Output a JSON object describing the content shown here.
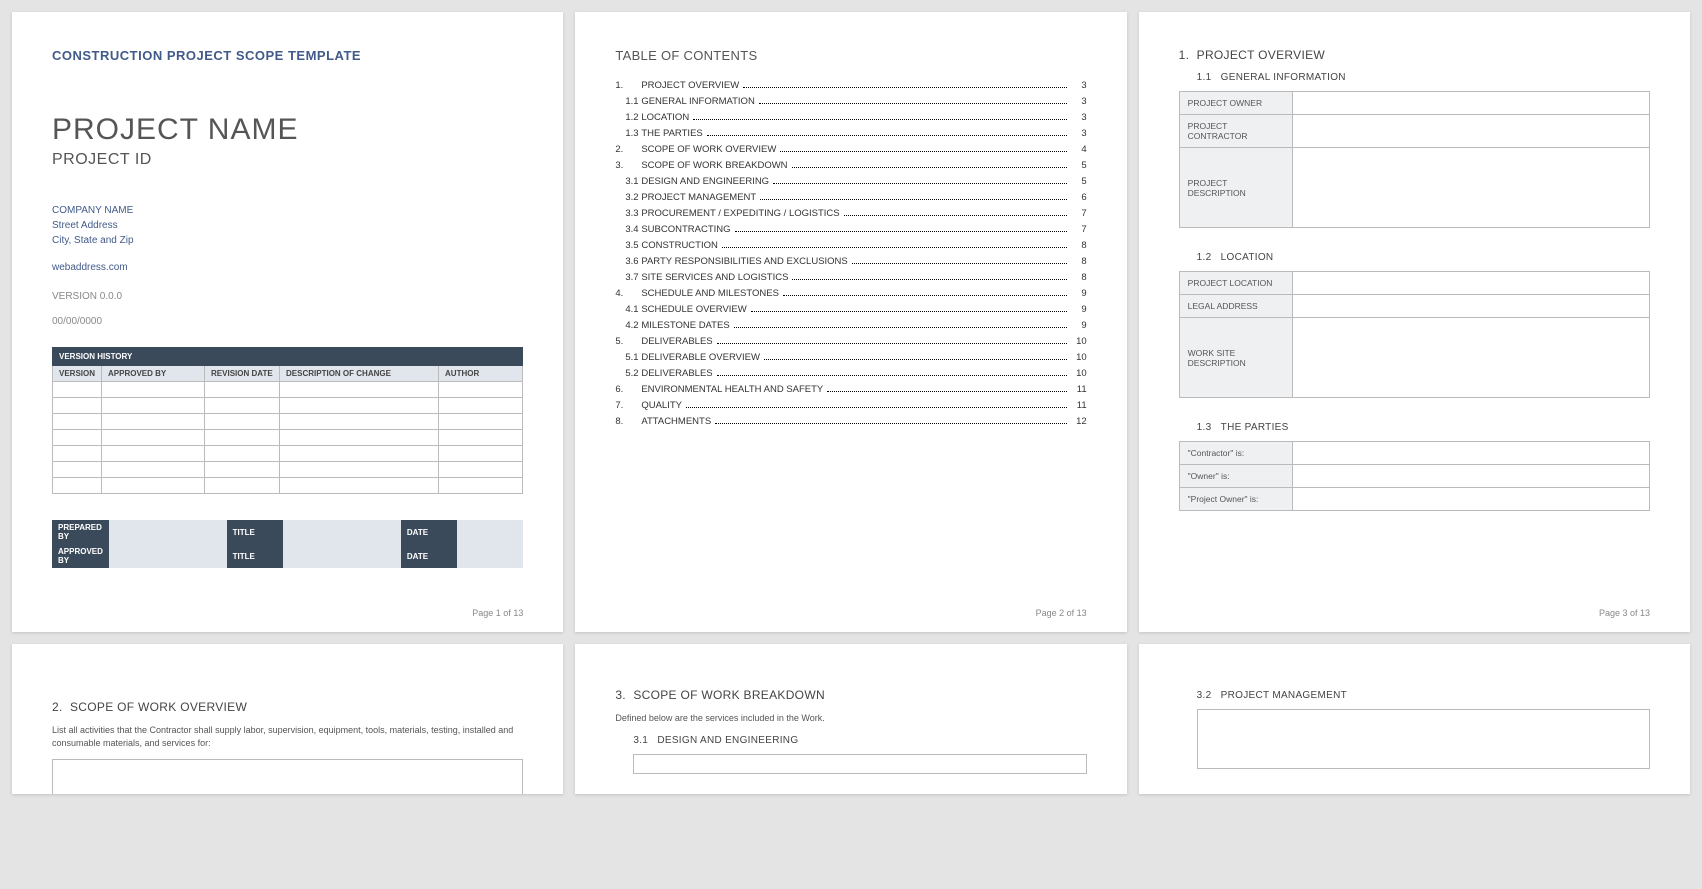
{
  "totalPages": "13",
  "page1": {
    "templateTitle": "CONSTRUCTION PROJECT SCOPE TEMPLATE",
    "projectName": "PROJECT NAME",
    "projectId": "PROJECT ID",
    "company": "COMPANY NAME",
    "street": "Street Address",
    "cityState": "City, State and Zip",
    "web": "webaddress.com",
    "version": "VERSION 0.0.0",
    "date": "00/00/0000",
    "versionHistoryTitle": "VERSION HISTORY",
    "colVersion": "VERSION",
    "colApproved": "APPROVED BY",
    "colRevDate": "REVISION DATE",
    "colDesc": "DESCRIPTION OF CHANGE",
    "colAuthor": "AUTHOR",
    "preparedBy": "PREPARED BY",
    "approvedBy": "APPROVED BY",
    "titleLabel": "TITLE",
    "dateLabel": "DATE",
    "footer": "Page 1 of 13"
  },
  "page2": {
    "title": "TABLE OF CONTENTS",
    "entries": [
      {
        "num": "1.",
        "label": "PROJECT OVERVIEW",
        "page": "3",
        "sub": false
      },
      {
        "num": "1.1",
        "label": "GENERAL INFORMATION",
        "page": "3",
        "sub": true
      },
      {
        "num": "1.2",
        "label": "LOCATION",
        "page": "3",
        "sub": true
      },
      {
        "num": "1.3",
        "label": "THE PARTIES",
        "page": "3",
        "sub": true
      },
      {
        "num": "2.",
        "label": "SCOPE OF WORK OVERVIEW",
        "page": "4",
        "sub": false
      },
      {
        "num": "3.",
        "label": "SCOPE OF WORK BREAKDOWN",
        "page": "5",
        "sub": false
      },
      {
        "num": "3.1",
        "label": "DESIGN AND ENGINEERING",
        "page": "5",
        "sub": true
      },
      {
        "num": "3.2",
        "label": "PROJECT MANAGEMENT",
        "page": "6",
        "sub": true
      },
      {
        "num": "3.3",
        "label": "PROCUREMENT / EXPEDITING / LOGISTICS",
        "page": "7",
        "sub": true
      },
      {
        "num": "3.4",
        "label": "SUBCONTRACTING",
        "page": "7",
        "sub": true
      },
      {
        "num": "3.5",
        "label": "CONSTRUCTION",
        "page": "8",
        "sub": true
      },
      {
        "num": "3.6",
        "label": "PARTY RESPONSIBILITIES AND EXCLUSIONS",
        "page": "8",
        "sub": true
      },
      {
        "num": "3.7",
        "label": "SITE SERVICES AND LOGISTICS",
        "page": "8",
        "sub": true
      },
      {
        "num": "4.",
        "label": "SCHEDULE AND MILESTONES",
        "page": "9",
        "sub": false
      },
      {
        "num": "4.1",
        "label": "SCHEDULE OVERVIEW",
        "page": "9",
        "sub": true
      },
      {
        "num": "4.2",
        "label": "MILESTONE DATES",
        "page": "9",
        "sub": true
      },
      {
        "num": "5.",
        "label": "DELIVERABLES",
        "page": "10",
        "sub": false
      },
      {
        "num": "5.1",
        "label": "DELIVERABLE OVERVIEW",
        "page": "10",
        "sub": true
      },
      {
        "num": "5.2",
        "label": "DELIVERABLES",
        "page": "10",
        "sub": true
      },
      {
        "num": "6.",
        "label": "ENVIRONMENTAL HEALTH AND SAFETY",
        "page": "11",
        "sub": false
      },
      {
        "num": "7.",
        "label": "QUALITY",
        "page": "11",
        "sub": false
      },
      {
        "num": "8.",
        "label": "ATTACHMENTS",
        "page": "12",
        "sub": false
      }
    ],
    "footer": "Page 2 of 13"
  },
  "page3": {
    "h1num": "1.",
    "h1": "PROJECT OVERVIEW",
    "s11num": "1.1",
    "s11": "GENERAL INFORMATION",
    "r_owner": "PROJECT OWNER",
    "r_contractor": "PROJECT CONTRACTOR",
    "r_desc": "PROJECT DESCRIPTION",
    "s12num": "1.2",
    "s12": "LOCATION",
    "r_loc": "PROJECT LOCATION",
    "r_legal": "LEGAL ADDRESS",
    "r_site": "WORK SITE DESCRIPTION",
    "s13num": "1.3",
    "s13": "THE PARTIES",
    "r_p1": "\"Contractor\" is:",
    "r_p2": "\"Owner\" is:",
    "r_p3": "\"Project Owner\" is:",
    "footer": "Page 3 of 13"
  },
  "page4": {
    "h1num": "2.",
    "h1": "SCOPE OF WORK OVERVIEW",
    "body": "List all activities that the Contractor shall supply labor, supervision, equipment, tools, materials, testing, installed and consumable materials, and services for:"
  },
  "page5": {
    "h1num": "3.",
    "h1": "SCOPE OF WORK BREAKDOWN",
    "body": "Defined below are the services included in the Work.",
    "s31num": "3.1",
    "s31": "DESIGN AND ENGINEERING"
  },
  "page6": {
    "s32num": "3.2",
    "s32": "PROJECT MANAGEMENT"
  }
}
